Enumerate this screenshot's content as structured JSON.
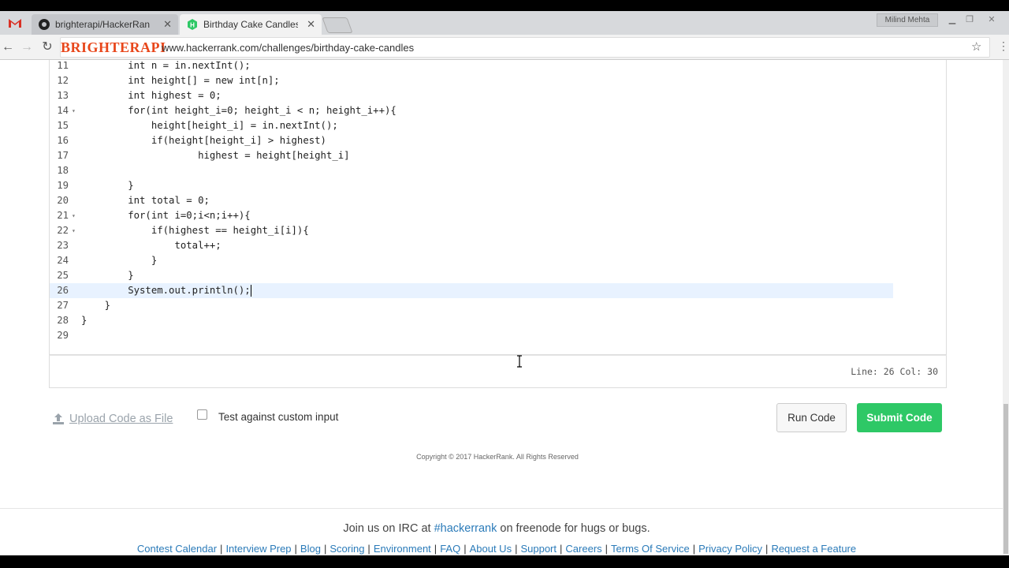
{
  "browser": {
    "tabs": [
      {
        "label": "brighterapi/HackerRank",
        "icon": "github-icon"
      },
      {
        "label": "Birthday Cake Candles | J",
        "icon": "hackerrank-icon"
      }
    ],
    "user": "Milind Mehta",
    "brand": "BRIGHTERAPI",
    "url": "www.hackerrank.com/challenges/birthday-cake-candles"
  },
  "editor": {
    "lines": [
      {
        "n": "11",
        "fold": "",
        "text": "        int n = in.nextInt();"
      },
      {
        "n": "12",
        "fold": "",
        "text": "        int height[] = new int[n];"
      },
      {
        "n": "13",
        "fold": "",
        "text": "        int highest = 0;"
      },
      {
        "n": "14",
        "fold": "▾",
        "text": "        for(int height_i=0; height_i < n; height_i++){"
      },
      {
        "n": "15",
        "fold": "",
        "text": "            height[height_i] = in.nextInt();"
      },
      {
        "n": "16",
        "fold": "",
        "text": "            if(height[height_i] > highest)"
      },
      {
        "n": "17",
        "fold": "",
        "text": "                    highest = height[height_i]"
      },
      {
        "n": "18",
        "fold": "",
        "text": ""
      },
      {
        "n": "19",
        "fold": "",
        "text": "        }"
      },
      {
        "n": "20",
        "fold": "",
        "text": "        int total = 0;"
      },
      {
        "n": "21",
        "fold": "▾",
        "text": "        for(int i=0;i<n;i++){"
      },
      {
        "n": "22",
        "fold": "▾",
        "text": "            if(highest == height_i[i]){"
      },
      {
        "n": "23",
        "fold": "",
        "text": "                total++;"
      },
      {
        "n": "24",
        "fold": "",
        "text": "            }"
      },
      {
        "n": "25",
        "fold": "",
        "text": "        }"
      },
      {
        "n": "26",
        "fold": "",
        "text": "        System.out.println();"
      },
      {
        "n": "27",
        "fold": "",
        "text": "    }"
      },
      {
        "n": "28",
        "fold": "",
        "text": "}"
      },
      {
        "n": "29",
        "fold": "",
        "text": ""
      }
    ],
    "current_line": "26",
    "status": "Line: 26 Col: 30"
  },
  "actions": {
    "upload_label": "Upload Code as File",
    "test_label": "Test against custom input",
    "run_label": "Run Code",
    "submit_label": "Submit Code"
  },
  "copyright": "Copyright © 2017 HackerRank. All Rights Reserved",
  "footer": {
    "irc_prefix": "Join us on IRC at ",
    "irc_channel": "#hackerrank",
    "irc_suffix": " on freenode for hugs or bugs.",
    "links": [
      "Contest Calendar",
      "Interview Prep",
      "Blog",
      "Scoring",
      "Environment",
      "FAQ",
      "About Us",
      "Support",
      "Careers",
      "Terms Of Service",
      "Privacy Policy",
      "Request a Feature"
    ]
  },
  "colors": {
    "submit": "#2ec866",
    "link": "#2b7bb9",
    "brand": "#e8461a"
  }
}
